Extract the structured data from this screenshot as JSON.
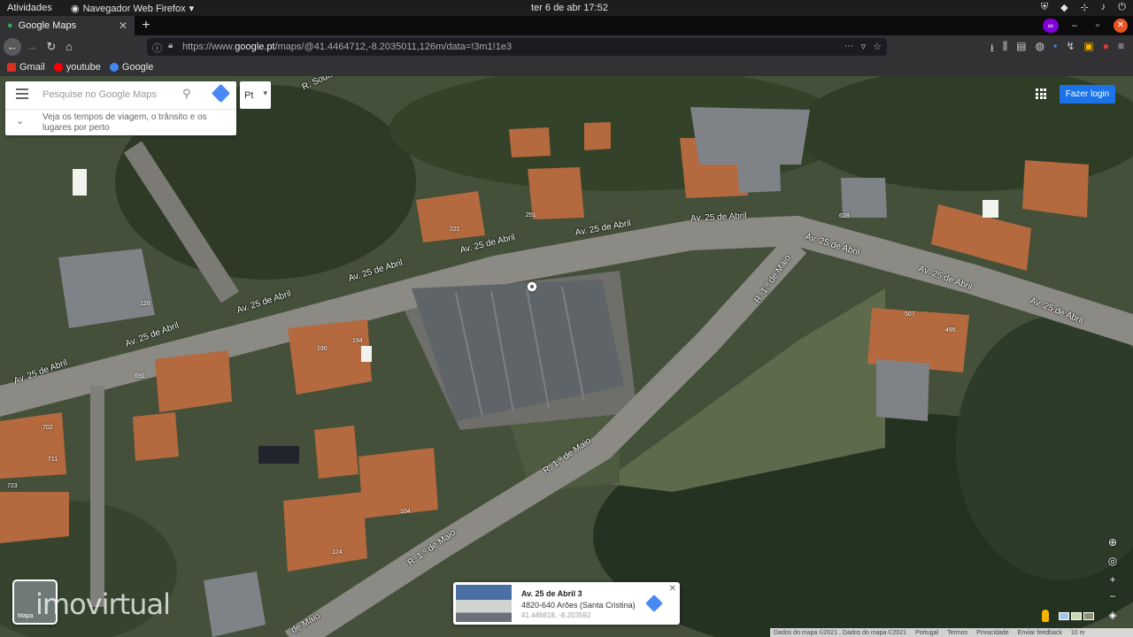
{
  "topbar": {
    "activities": "Atividades",
    "app_menu": "Navegador Web Firefox",
    "clock": "ter 6 de abr  17:52"
  },
  "browser": {
    "tab_title": "Google Maps",
    "url_prefix": "https://www.",
    "url_domain": "google.pt",
    "url_path": "/maps/@41.4464712,-8.2035011,126m/data=!3m1!1e3",
    "private_badge": "∞"
  },
  "bookmarks": [
    {
      "label": "Gmail",
      "color": "#d93025"
    },
    {
      "label": "youtube",
      "color": "#ff0000"
    },
    {
      "label": "Google",
      "color": "#4285f4"
    }
  ],
  "search": {
    "placeholder": "Pesquise no Google Maps",
    "hint": "Veja os tempos de viagem, o trânsito e os lugares por perto",
    "lang_label": "Pt"
  },
  "header": {
    "login_label": "Fazer login"
  },
  "map_labels": {
    "roads": [
      "R. Souto d...",
      "Av. 25 de Abril",
      "Av. 25 de Abril",
      "Av. 25 de Abril",
      "Av. 25 de Abril",
      "Av. 25 de Abril",
      "Av. 25 de Abril",
      "Av. 25 de Abril",
      "Av. 25 de Abril",
      "Av. 25 de Abril",
      "R. 1.º de Maio",
      "R. 1.º de Maio",
      "R. 1.º de Maio",
      "de Maio"
    ],
    "numbers": [
      "221",
      "251",
      "628",
      "129",
      "190",
      "194",
      "691",
      "702",
      "711",
      "723",
      "104",
      "124",
      "507",
      "495"
    ]
  },
  "layers": {
    "label": "Mapa"
  },
  "watermark": "imovirtual",
  "place_card": {
    "title": "Av. 25 de Abril 3",
    "address": "4820-640 Arões (Santa Cristina)",
    "coords": "41.446618, -8.203592"
  },
  "footer": {
    "items": [
      "Dados do mapa ©2021 , Dados do mapa ©2021",
      "Portugal",
      "Termos",
      "Privacidade",
      "Enviar feedback",
      "10 m"
    ]
  },
  "colors": {
    "firefox_private": "#8000d7",
    "login_button": "#1a73e8",
    "ubuntu_close": "#e95420"
  }
}
